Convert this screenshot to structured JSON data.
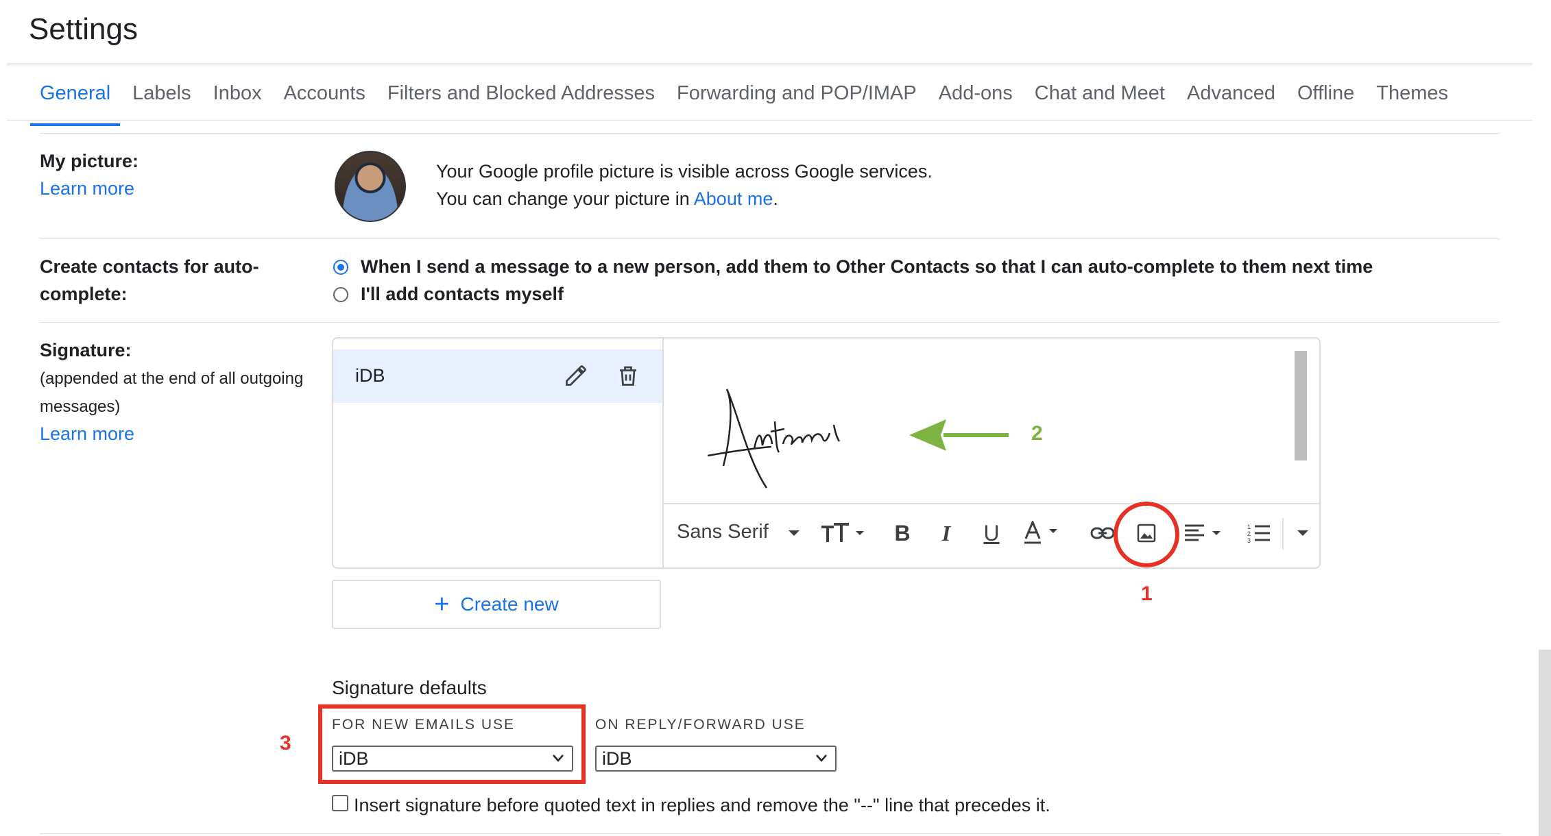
{
  "page": {
    "title": "Settings"
  },
  "tabs": [
    {
      "label": "General",
      "active": true
    },
    {
      "label": "Labels"
    },
    {
      "label": "Inbox"
    },
    {
      "label": "Accounts"
    },
    {
      "label": "Filters and Blocked Addresses"
    },
    {
      "label": "Forwarding and POP/IMAP"
    },
    {
      "label": "Add-ons"
    },
    {
      "label": "Chat and Meet"
    },
    {
      "label": "Advanced"
    },
    {
      "label": "Offline"
    },
    {
      "label": "Themes"
    }
  ],
  "my_picture": {
    "label": "My picture:",
    "learn_more": "Learn more",
    "line1": "Your Google profile picture is visible across Google services.",
    "line2_prefix": "You can change your picture in ",
    "line2_link": "About me",
    "line2_suffix": "."
  },
  "contacts": {
    "label_line1": "Create contacts for auto-",
    "label_line2": "complete:",
    "option1": "When I send a message to a new person, add them to Other Contacts so that I can auto-complete to them next time",
    "option2": "I'll add contacts myself",
    "selected": 1
  },
  "signature": {
    "label": "Signature:",
    "desc_line1": "(appended at the end of all outgoing",
    "desc_line2": "messages)",
    "learn_more": "Learn more",
    "items": [
      {
        "name": "iDB"
      }
    ],
    "editor_image": "handwritten signature",
    "toolbar": {
      "font": "Sans Serif",
      "icons": [
        "font-size-icon",
        "bold-icon",
        "italic-icon",
        "underline-icon",
        "text-color-icon",
        "link-icon",
        "insert-image-icon",
        "align-icon",
        "numbered-list-icon",
        "more-options-icon"
      ]
    },
    "create_new": "Create new"
  },
  "defaults": {
    "title": "Signature defaults",
    "new_label": "FOR NEW EMAILS USE",
    "new_value": "iDB",
    "reply_label": "ON REPLY/FORWARD USE",
    "reply_value": "iDB",
    "insert_before": "Insert signature before quoted text in replies and remove the \"--\" line that precedes it."
  },
  "annotations": {
    "step1": "1",
    "step2": "2",
    "step3": "3",
    "red": "#e53225",
    "green": "#7cb342"
  },
  "colors": {
    "accent": "#1a73e8"
  }
}
